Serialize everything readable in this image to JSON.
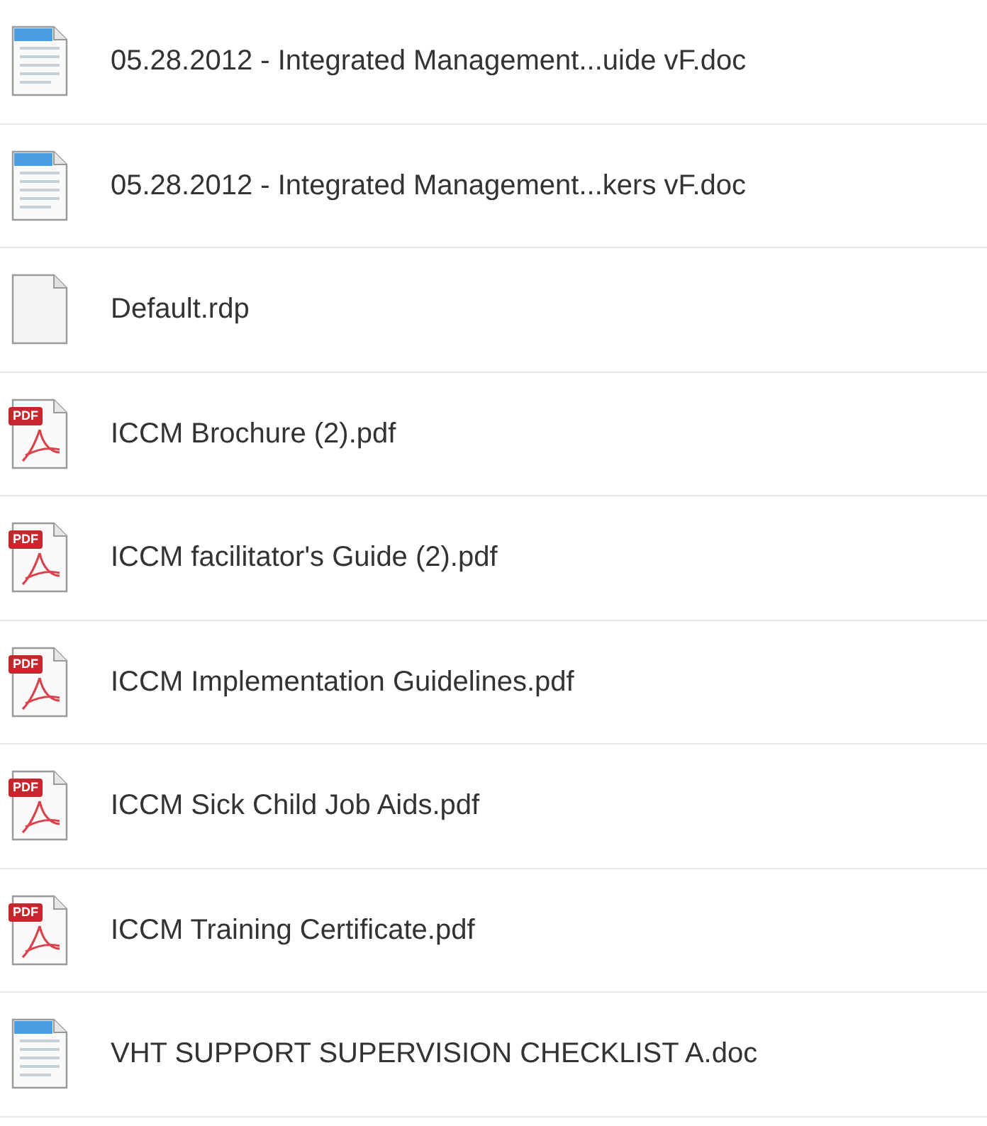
{
  "files": [
    {
      "kind": "doc",
      "name": "05.28.2012 - Integrated Management...uide vF.doc"
    },
    {
      "kind": "doc",
      "name": "05.28.2012 - Integrated Management...kers vF.doc"
    },
    {
      "kind": "blank",
      "name": "Default.rdp"
    },
    {
      "kind": "pdf",
      "badge": "PDF",
      "name": "ICCM Brochure (2).pdf"
    },
    {
      "kind": "pdf",
      "badge": "PDF",
      "name": "ICCM facilitator's Guide (2).pdf"
    },
    {
      "kind": "pdf",
      "badge": "PDF",
      "name": "ICCM Implementation Guidelines.pdf"
    },
    {
      "kind": "pdf",
      "badge": "PDF",
      "name": "ICCM Sick Child Job Aids.pdf"
    },
    {
      "kind": "pdf",
      "badge": "PDF",
      "name": "ICCM Training Certificate.pdf"
    },
    {
      "kind": "doc",
      "name": "VHT SUPPORT SUPERVISION CHECKLIST A.doc"
    }
  ]
}
